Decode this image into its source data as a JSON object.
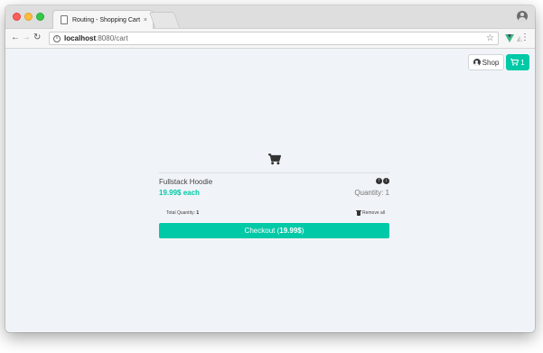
{
  "browser": {
    "tab_title": "Routing - Shopping Cart",
    "tab_close": "×",
    "url_host": "localhost",
    "url_rest": ":8080/cart"
  },
  "header": {
    "shop_label": "Shop",
    "cart_count": "1"
  },
  "cart": {
    "items": [
      {
        "name": "Fullstack Hoodie",
        "price_each": "19.99$ each",
        "quantity": "Quantity: 1"
      }
    ],
    "total_quantity_label": "Total Quantity:",
    "total_quantity_value": "1",
    "remove_all_label": "Remove all",
    "checkout_label": "Checkout (",
    "checkout_amount": "19.99$",
    "checkout_close": ")"
  },
  "colors": {
    "accent": "#00c9a7",
    "background": "#f0f4f8"
  },
  "icons": {
    "cart": "shopping-cart-icon",
    "user": "user-circle-icon",
    "increase": "plus-circle-icon",
    "decrease": "minus-circle-icon",
    "trash": "trash-icon"
  }
}
